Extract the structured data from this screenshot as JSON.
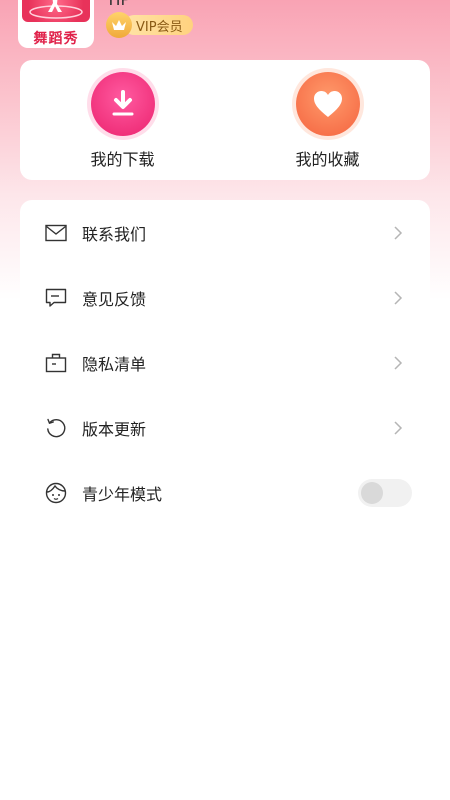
{
  "profile": {
    "app_logo_text": "舞蹈秀",
    "username": "TIP",
    "vip_label": "VIP会员"
  },
  "quick_actions": [
    {
      "label": "我的下载",
      "icon": "download-icon"
    },
    {
      "label": "我的收藏",
      "icon": "heart-icon"
    }
  ],
  "menu": {
    "items": [
      {
        "label": "联系我们",
        "icon": "mail-icon"
      },
      {
        "label": "意见反馈",
        "icon": "feedback-icon"
      },
      {
        "label": "隐私清单",
        "icon": "briefcase-icon"
      },
      {
        "label": "版本更新",
        "icon": "refresh-icon"
      }
    ],
    "toggle_item": {
      "label": "青少年模式",
      "icon": "youth-face-icon",
      "enabled": false
    }
  },
  "colors": {
    "download_accent": "#f0307a",
    "favorite_accent": "#f7714a",
    "vip_gold": "#ffd27f"
  }
}
